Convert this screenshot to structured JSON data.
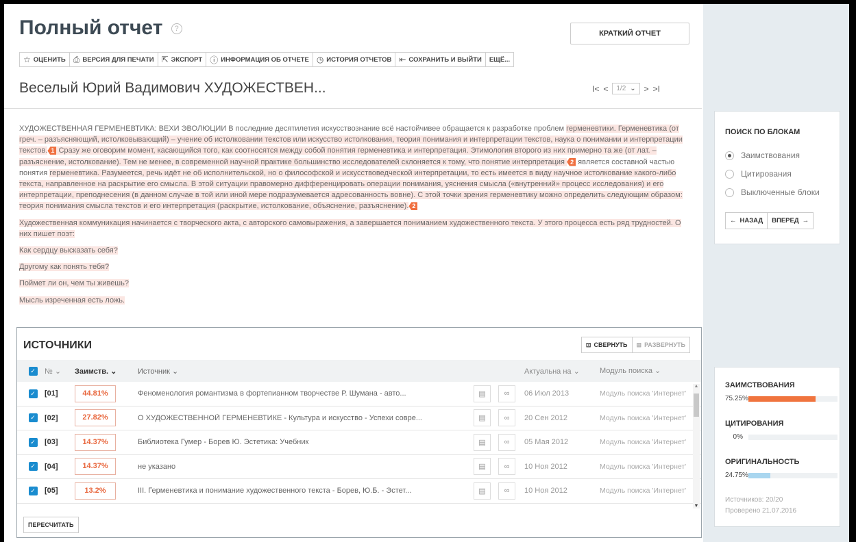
{
  "header": {
    "title": "Полный отчет",
    "help": "?",
    "short_report_label": "КРАТКИЙ ОТЧЕТ"
  },
  "toolbar": {
    "items": [
      {
        "icon": "star-icon",
        "label": "ОЦЕНИТЬ"
      },
      {
        "icon": "printer-icon",
        "label": "ВЕРСИЯ ДЛЯ ПЕЧАТИ"
      },
      {
        "icon": "export-icon",
        "label": "ЭКСПОРТ"
      },
      {
        "icon": "info-icon",
        "label": "ИНФОРМАЦИЯ ОБ ОТЧЕТЕ"
      },
      {
        "icon": "history-icon",
        "label": "ИСТОРИЯ ОТЧЕТОВ"
      },
      {
        "icon": "save-exit-icon",
        "label": "СОХРАНИТЬ И ВЫЙТИ"
      },
      {
        "icon": "",
        "label": "ЕЩЁ..."
      }
    ]
  },
  "document": {
    "title": "Веселый Юрий Вадимович ХУДОЖЕСТВЕН...",
    "page_current": "1/2",
    "first": "I<",
    "prev": "<",
    "next": ">",
    "last": ">I"
  },
  "text": {
    "p1_a": "ХУДОЖЕСТВЕННАЯ ГЕРМЕНЕВТИКА: ВЕХИ ЭВОЛЮЦИИ В последние десятилетия искусствознание всё настойчивее обращается к разработке проблем ",
    "p1_hl1": " герменевтики. Герменевтика (от греч. – разъясняющий, истолковывающий) – учение об истолковании текстов или искусство истолкования, теория понимания и интерпретации текстов, наука о понимании и интерпретации текстов.",
    "mark1": "1",
    "p1_hl2": " Сразу же оговорим момент, касающийся того, как соотносятся между собой понятия герменевтика и интерпретация. Этимология второго из них примерно та же (от лат. – разъяснение, истолкование). Тем не менее, в современной научной практике большинство исследователей склоняется к тому, что понятие интерпретация ",
    "mark2": "2",
    "p1_b": " является составной частью понятия ",
    "p1_hl3": "  герменевтика. Разумеется, речь идёт не об исполнительской, но о философской и искусствоведческой интерпретации, то есть имеется в виду научное истолкование какого-либо текста, направленное на раскрытие его смысла. В этой ситуации правомерно дифференцировать операции понимания, уяснения смысла («внутренний» процесс исследования) и его интерпретации, преподнесения (в данном случае в той или иной мере подразумевается адресованность вовне). С этой точки зрения герменевтику можно определить следующим образом: теория понимания смысла текстов и его интерпретация (раскрытие, истолкование, объяснение, разъяснение).",
    "mark3": "2",
    "p2": "Художественная коммуникация начинается с творческого акта, с авторского самовыражения, а завершается пониманием художественного текста. У этого процесса есть ряд трудностей. О них пишет поэт:",
    "p3": "Как сердцу высказать себя?",
    "p4": "Другому как понять тебя?",
    "p5": "Поймет ли он, чем ты живешь?",
    "p6": "Мысль изреченная есть ложь."
  },
  "sources": {
    "title": "ИСТОЧНИКИ",
    "collapse_label": "СВЕРНУТЬ",
    "expand_label": "РАЗВЕРНУТЬ",
    "columns": {
      "no": "№",
      "borrow": "Заимств.",
      "source": "Источник",
      "date": "Актуальна на",
      "module": "Модуль поиска"
    },
    "rows": [
      {
        "no": "[01]",
        "pct": "44.81%",
        "source": "Феноменология романтизма в фортепианном творчестве Р. Шумана - авто...",
        "date": "06 Июл 2013",
        "module": "Модуль поиска 'Интернет'"
      },
      {
        "no": "[02]",
        "pct": "27.82%",
        "source": "О ХУДОЖЕСТВЕННОЙ ГЕРМЕНЕВТИКЕ - Культура и искусство - Успехи совре...",
        "date": "20 Сен 2012",
        "module": "Модуль поиска 'Интернет'"
      },
      {
        "no": "[03]",
        "pct": "14.37%",
        "source": "Библиотека Гумер - Борев Ю. Эстетика: Учебник",
        "date": "05 Мая 2012",
        "module": "Модуль поиска 'Интернет'"
      },
      {
        "no": "[04]",
        "pct": "14.37%",
        "source": "не указано",
        "date": "10 Ноя 2012",
        "module": "Модуль поиска 'Интернет'"
      },
      {
        "no": "[05]",
        "pct": "13.2%",
        "source": "III. Герменевтика и понимание художественного текста - Борев, Ю.Б. - Эстет...",
        "date": "10 Ноя 2012",
        "module": "Модуль поиска 'Интернет'"
      }
    ],
    "recalc_label": "ПЕРЕСЧИТАТЬ"
  },
  "block_search": {
    "title": "ПОИСК ПО БЛОКАМ",
    "options": [
      "Заимствования",
      "Цитирования",
      "Выключенные блоки"
    ],
    "selected": 0,
    "back_label": "НАЗАД",
    "forward_label": "ВПЕРЕД"
  },
  "stats": {
    "borrow_label": "ЗАИМСТВОВАНИЯ",
    "borrow_value": "75.25%",
    "borrow_fraction": 0.7525,
    "cite_label": "ЦИТИРОВАНИЯ",
    "cite_value": "0%",
    "cite_fraction": 0,
    "orig_label": "ОРИГИНАЛЬНОСТЬ",
    "orig_value": "24.75%",
    "orig_fraction": 0.2475,
    "sources_count": "Источников: 20/20",
    "checked": "Проверено 21.07.2016",
    "colors": {
      "borrow": "#f0743e",
      "cite": "#8cc8e8",
      "orig": "#a9d6ef"
    }
  }
}
